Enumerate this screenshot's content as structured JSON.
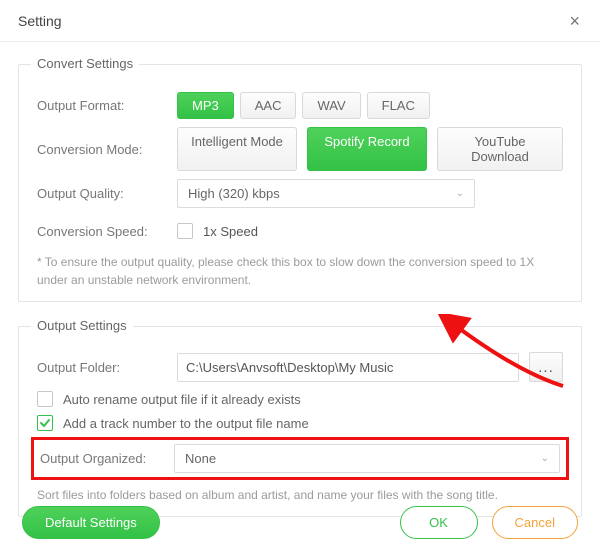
{
  "window": {
    "title": "Setting"
  },
  "convert": {
    "legend": "Convert Settings",
    "outputFormatLabel": "Output Format:",
    "formats": {
      "mp3": "MP3",
      "aac": "AAC",
      "wav": "WAV",
      "flac": "FLAC"
    },
    "conversionModeLabel": "Conversion Mode:",
    "modes": {
      "intelligent": "Intelligent Mode",
      "spotify": "Spotify Record",
      "youtube": "YouTube Download"
    },
    "outputQualityLabel": "Output Quality:",
    "qualityValue": "High (320) kbps",
    "conversionSpeedLabel": "Conversion Speed:",
    "speedCheckboxLabel": "1x Speed",
    "speedHint": "* To ensure the output quality, please check this box to slow down the conversion speed to 1X under an unstable network environment."
  },
  "output": {
    "legend": "Output Settings",
    "outputFolderLabel": "Output Folder:",
    "outputFolderValue": "C:\\Users\\Anvsoft\\Desktop\\My Music",
    "browseLabel": "...",
    "autoRenameLabel": "Auto rename output file if it already exists",
    "addTrackNumberLabel": "Add a track number to the output file name",
    "organizedLabel": "Output Organized:",
    "organizedValue": "None",
    "organizedHint": "Sort files into folders based on album and artist, and name your files with the song title."
  },
  "footer": {
    "defaultSettings": "Default Settings",
    "ok": "OK",
    "cancel": "Cancel"
  }
}
